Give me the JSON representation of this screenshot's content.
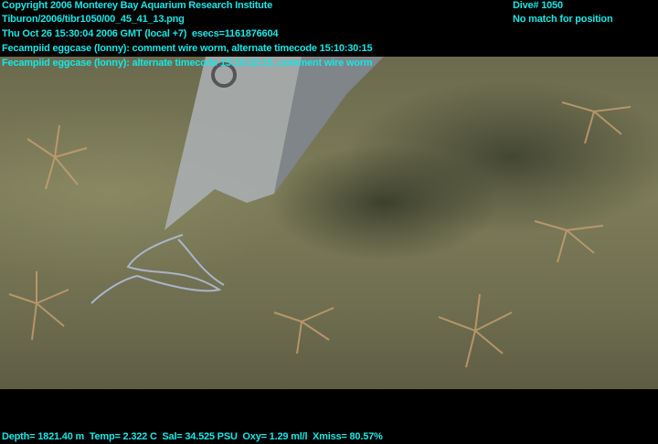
{
  "overlay": {
    "copyright": "Copyright 2006 Monterey Bay Aquarium Research Institute",
    "file": "Tiburon/2006/tibr1050/00_45_41_13.png",
    "time": "Thu Oct 26 15:30:04 2006 GMT (local +7)  esecs=1161876604",
    "annotation1": "Fecampiid eggcase (lonny): comment wire worm, alternate timecode 15:10:30:15",
    "annotation2": "Fecampiid eggcase (lonny): alternate timecode 15:10:32:15, comment wire worm",
    "dive": "Dive# 1050",
    "position": "No match for position",
    "sensors": "Depth= 1821.40 m  Temp= 2.322 C  Sal= 34.525 PSU  Oxy= 1.29 ml/l  Xmiss= 80.57%"
  },
  "colors": {
    "text": "#18e6e6"
  }
}
